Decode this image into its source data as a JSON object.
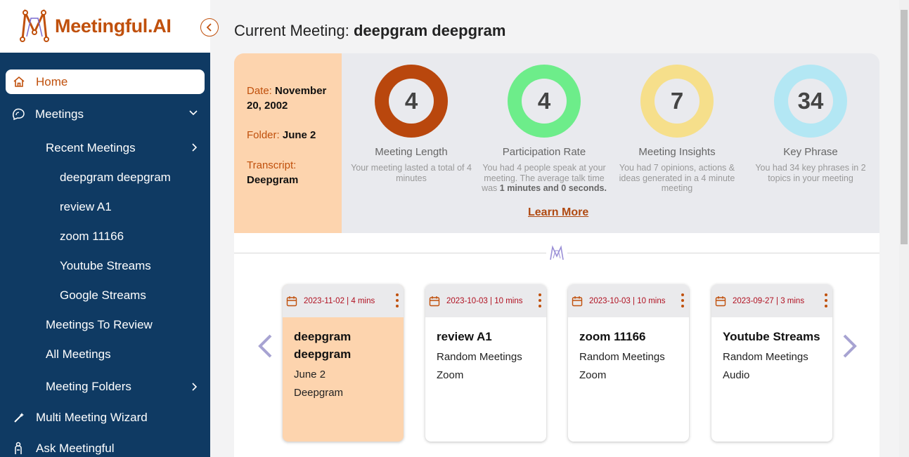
{
  "brand": {
    "name": "Meetingful.AI",
    "color": "#c0500c"
  },
  "sidebar": {
    "home": "Home",
    "meetings": "Meetings",
    "recent_meetings": "Recent Meetings",
    "recent": [
      "deepgram deepgram",
      "review A1",
      "zoom 11166",
      "Youtube Streams",
      "Google Streams"
    ],
    "to_review": "Meetings To Review",
    "all_meetings": "All Meetings",
    "folders": "Meeting Folders",
    "wizard": "Multi Meeting Wizard",
    "ask": "Ask Meetingful"
  },
  "header": {
    "prefix": "Current Meeting:",
    "name": "deepgram deepgram"
  },
  "meeting_info": {
    "date_label": "Date:",
    "date": "November 20, 2002",
    "folder_label": "Folder:",
    "folder": "June 2",
    "transcript_label": "Transcript:",
    "transcript": "Deepgram"
  },
  "stats": [
    {
      "value": "4",
      "title": "Meeting Length",
      "desc": "Your meeting lasted a total of 4 minutes",
      "color": "#b9470d"
    },
    {
      "value": "4",
      "title": "Participation Rate",
      "desc": "You had 4 people speak at your meeting. The average talk time was",
      "desc_bold": "1 minutes and 0 seconds.",
      "color": "#6ded8a"
    },
    {
      "value": "7",
      "title": "Meeting Insights",
      "desc": "You had 7 opinions, actions & ideas generated in a 4 minute meeting",
      "color": "#f6df8b"
    },
    {
      "value": "34",
      "title": "Key Phrase",
      "desc": "You had 34 key phrases in 2 topics in your meeting",
      "color": "#b3e7f4"
    }
  ],
  "learn_more": "Learn More",
  "cards": [
    {
      "date": "2023-11-02 | 4 mins",
      "title": "deepgram deepgram",
      "folder": "June 2",
      "source": "Deepgram"
    },
    {
      "date": "2023-10-03 | 10 mins",
      "title": "review A1",
      "folder": "Random Meetings",
      "source": "Zoom"
    },
    {
      "date": "2023-10-03 | 10 mins",
      "title": "zoom 11166",
      "folder": "Random Meetings",
      "source": "Zoom"
    },
    {
      "date": "2023-09-27 | 3 mins",
      "title": "Youtube Streams",
      "folder": "Random Meetings",
      "source": "Audio"
    }
  ]
}
